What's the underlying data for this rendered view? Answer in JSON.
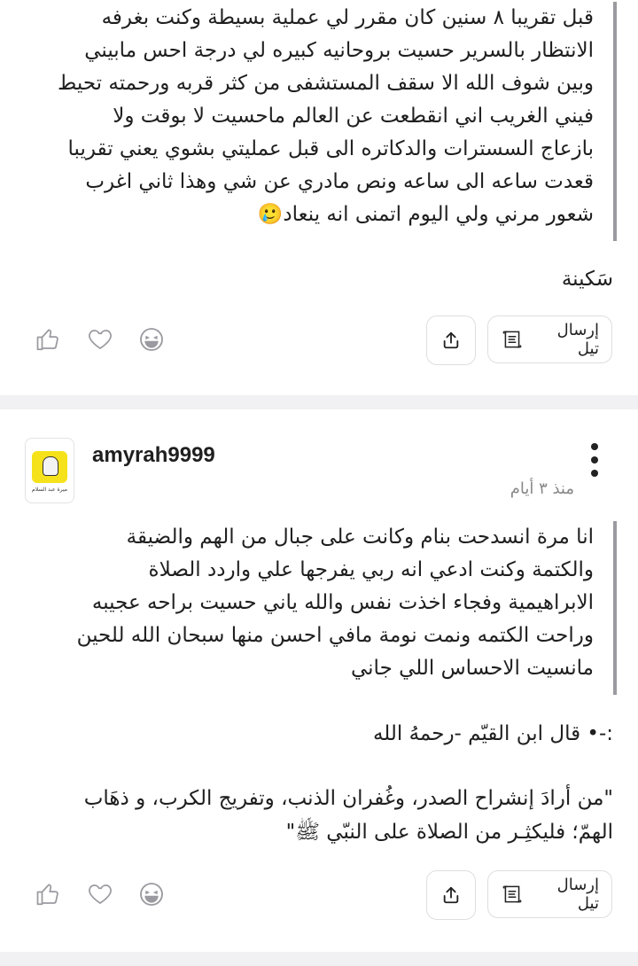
{
  "post1": {
    "quote": "قبل تقريبا ٨ سنين كان مقرر لي عملية بسيطة وكنت بغرفه\nالانتظار بالسرير حسيت بروحانيه كبيره لي درجة احس مابيني\nوبين شوف الله الا سقف المستشفى من كثر قربه ورحمته تحيط\nفيني الغريب اني انقطعت عن العالم ماحسيت لا بوقت ولا\nبازعاج السسترات والدكاتره الى قبل عمليتي بشوي يعني تقريبا\nقعدت ساعه الى ساعه ونص مادري عن شي وهذا ثاني اغرب\nشعور مرني ولي اليوم اتمنى انه ينعاد🥲",
    "text": "سَكينة",
    "send_label": "إرسال تيل"
  },
  "post2": {
    "username": "amyrah9999",
    "time": "منذ ٣ أيام",
    "avatar_text": "ميرة عبد السلام",
    "quote": "انا مرة انسدحت بنام وكانت على جبال من الهم والضيقة\nوالكتمة وكنت ادعي انه ربي يفرجها علي واردد الصلاة\nالابراهيمية وفجاء اخذت نفس والله ياني حسيت براحه عجيبه\nوراحت الكتمه ونمت نومة مافي احسن منها سبحان الله للحين\nمانسيت الاحساس اللي جاني",
    "text_line1": ":-• قال ابن القيّم -رحمهُ الله",
    "text_body": "\"من أرادَ إنشراح الصدر، وغُفران الذنب، وتفريج الكرب، و ذهَاب\nالهمّ؛ فليكثِـر من الصلاة على النبّي ﷺ\"",
    "send_label": "إرسال تيل"
  },
  "icons": [
    "like-icon",
    "heart-icon",
    "laugh-icon",
    "share-icon",
    "scroll-icon",
    "more-icon"
  ],
  "colors": {
    "separator": "#f1f1f3",
    "quote_bar": "#9a9aa0",
    "icon_gray": "#9a9aa0"
  }
}
